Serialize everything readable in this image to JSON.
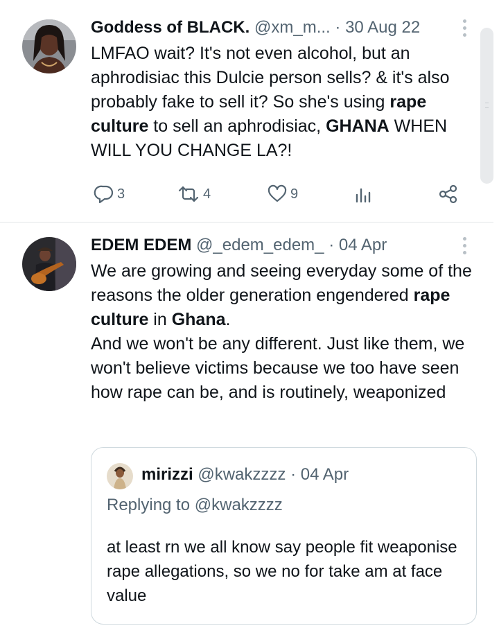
{
  "tweet1": {
    "author_name": "Goddess of BLACK.",
    "handle": "@xm_m...",
    "separator": "·",
    "date": "30 Aug 22",
    "text": [
      {
        "t": "LMFAO wait? It's not even alcohol, but an aphrodisiac this Dulcie person sells? & it's also probably fake to sell it? So she's using ",
        "bold": false
      },
      {
        "t": "rape culture",
        "bold": true
      },
      {
        "t": " to sell an aphrodisiac, ",
        "bold": false
      },
      {
        "t": "GHANA",
        "bold": true
      },
      {
        "t": " WHEN WILL YOU CHANGE LA?!",
        "bold": false
      }
    ],
    "actions": {
      "replies": "3",
      "retweets": "4",
      "likes": "9"
    }
  },
  "tweet2": {
    "author_name": "EDEM EDEM",
    "handle": "@_edem_edem_",
    "separator": "·",
    "date": "04 Apr",
    "text": [
      {
        "t": "We are growing and seeing everyday some of the reasons the older generation engendered ",
        "bold": false
      },
      {
        "t": "rape culture",
        "bold": true
      },
      {
        "t": " in ",
        "bold": false
      },
      {
        "t": "Ghana",
        "bold": true
      },
      {
        "t": ".",
        "bold": false
      },
      {
        "t": "\nAnd we won't be any different. Just like them, we won't believe victims because we too have seen how rape can be, and is routinely, weaponized",
        "bold": false
      }
    ],
    "quote": {
      "author_name": "mirizzi",
      "handle": "@kwakzzzz",
      "separator": "·",
      "date": "04 Apr",
      "replying_prefix": "Replying to",
      "replying_handle": "@kwakzzzz",
      "text": "at least rn we all know say people fit weaponise rape allegations, so we no for take am at face value"
    }
  },
  "icons": {
    "reply": "reply-icon",
    "retweet": "retweet-icon",
    "like": "heart-icon",
    "views": "views-icon",
    "share": "share-icon",
    "more": "more-vertical-icon"
  },
  "colors": {
    "text": "#0f1419",
    "secondary": "#536471",
    "divider": "#e3e6e8",
    "quote_border": "#cfd9de"
  }
}
